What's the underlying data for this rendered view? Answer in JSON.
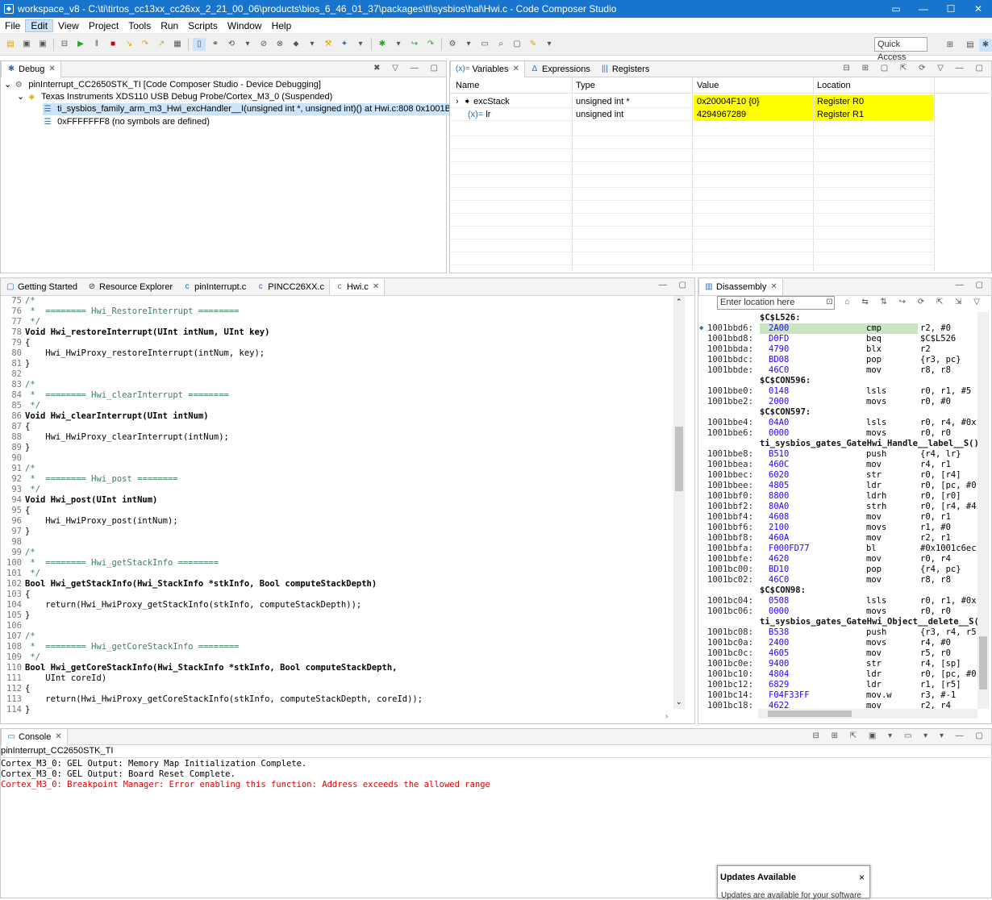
{
  "window": {
    "title": "workspace_v8 - C:\\ti\\tirtos_cc13xx_cc26xx_2_21_00_06\\products\\bios_6_46_01_37\\packages\\ti\\sysbios\\hal\\Hwi.c - Code Composer Studio",
    "minimize": "—",
    "maximize": "☐",
    "close": "✕"
  },
  "menu": [
    "File",
    "Edit",
    "View",
    "Project",
    "Tools",
    "Run",
    "Scripts",
    "Window",
    "Help"
  ],
  "quick_access": "Quick Access",
  "debug": {
    "tab": "Debug",
    "rows": [
      "pinInterrupt_CC2650STK_TI [Code Composer Studio - Device Debugging]",
      "Texas Instruments XDS110 USB Debug Probe/Cortex_M3_0 (Suspended)",
      "ti_sysbios_family_arm_m3_Hwi_excHandler__I(unsigned int *, unsigned int)() at Hwi.c:808 0x1001BBD6",
      "0xFFFFFFF8  (no symbols are defined)"
    ]
  },
  "vars": {
    "tabs": [
      "Variables",
      "Expressions",
      "Registers"
    ],
    "tab_icons": [
      "(x)=",
      "∆",
      "|||"
    ],
    "headers": [
      "Name",
      "Type",
      "Value",
      "Location"
    ],
    "rows": [
      {
        "name": "excStack",
        "type": "unsigned int *",
        "value": "0x20004F10 {0}",
        "location": "Register R0"
      },
      {
        "name": "lr",
        "type": "unsigned int",
        "value": "4294967289",
        "location": "Register R1"
      }
    ]
  },
  "editor": {
    "tabs": [
      "Getting Started",
      "Resource Explorer",
      "pinInterrupt.c",
      "PINCC26XX.c",
      "Hwi.c"
    ],
    "lines": [
      {
        "n": "75",
        "t": "/*"
      },
      {
        "n": "76",
        "t": " *  ======== Hwi_RestoreInterrupt ========"
      },
      {
        "n": "77",
        "t": " */"
      },
      {
        "n": "78",
        "t": "Void Hwi_restoreInterrupt(UInt intNum, UInt key)"
      },
      {
        "n": "79",
        "t": "{"
      },
      {
        "n": "80",
        "t": "    Hwi_HwiProxy_restoreInterrupt(intNum, key);"
      },
      {
        "n": "81",
        "t": "}"
      },
      {
        "n": "82",
        "t": ""
      },
      {
        "n": "83",
        "t": "/*"
      },
      {
        "n": "84",
        "t": " *  ======== Hwi_clearInterrupt ========"
      },
      {
        "n": "85",
        "t": " */"
      },
      {
        "n": "86",
        "t": "Void Hwi_clearInterrupt(UInt intNum)"
      },
      {
        "n": "87",
        "t": "{"
      },
      {
        "n": "88",
        "t": "    Hwi_HwiProxy_clearInterrupt(intNum);"
      },
      {
        "n": "89",
        "t": "}"
      },
      {
        "n": "90",
        "t": ""
      },
      {
        "n": "91",
        "t": "/*"
      },
      {
        "n": "92",
        "t": " *  ======== Hwi_post ========"
      },
      {
        "n": "93",
        "t": " */"
      },
      {
        "n": "94",
        "t": "Void Hwi_post(UInt intNum)"
      },
      {
        "n": "95",
        "t": "{"
      },
      {
        "n": "96",
        "t": "    Hwi_HwiProxy_post(intNum);"
      },
      {
        "n": "97",
        "t": "}"
      },
      {
        "n": "98",
        "t": ""
      },
      {
        "n": "99",
        "t": "/*"
      },
      {
        "n": "100",
        "t": " *  ======== Hwi_getStackInfo ========"
      },
      {
        "n": "101",
        "t": " */"
      },
      {
        "n": "102",
        "t": "Bool Hwi_getStackInfo(Hwi_StackInfo *stkInfo, Bool computeStackDepth)"
      },
      {
        "n": "103",
        "t": "{"
      },
      {
        "n": "104",
        "t": "    return(Hwi_HwiProxy_getStackInfo(stkInfo, computeStackDepth));"
      },
      {
        "n": "105",
        "t": "}"
      },
      {
        "n": "106",
        "t": ""
      },
      {
        "n": "107",
        "t": "/*"
      },
      {
        "n": "108",
        "t": " *  ======== Hwi_getCoreStackInfo ========"
      },
      {
        "n": "109",
        "t": " */"
      },
      {
        "n": "110",
        "t": "Bool Hwi_getCoreStackInfo(Hwi_StackInfo *stkInfo, Bool computeStackDepth,"
      },
      {
        "n": "111",
        "t": "    UInt coreId)"
      },
      {
        "n": "112",
        "t": "{"
      },
      {
        "n": "113",
        "t": "    return(Hwi_HwiProxy_getCoreStackInfo(stkInfo, computeStackDepth, coreId));"
      },
      {
        "n": "114",
        "t": "}"
      }
    ]
  },
  "disasm": {
    "tab": "Disassembly",
    "location_placeholder": "Enter location here",
    "lines": [
      {
        "label": "$C$L526:"
      },
      {
        "a": "1001bbd6:",
        "o": "2A00",
        "m": "cmp",
        "r": "r2, #0",
        "cur": true
      },
      {
        "a": "1001bbd8:",
        "o": "D0FD",
        "m": "beq",
        "r": "$C$L526"
      },
      {
        "a": "1001bbda:",
        "o": "4790",
        "m": "blx",
        "r": "r2"
      },
      {
        "a": "1001bbdc:",
        "o": "BD08",
        "m": "pop",
        "r": "{r3, pc}"
      },
      {
        "a": "1001bbde:",
        "o": "46C0",
        "m": "mov",
        "r": "r8, r8"
      },
      {
        "label": "$C$CON596:"
      },
      {
        "a": "1001bbe0:",
        "o": "0148",
        "m": "lsls",
        "r": "r0, r1, #5"
      },
      {
        "a": "1001bbe2:",
        "o": "2000",
        "m": "movs",
        "r": "r0, #0"
      },
      {
        "label": "$C$CON597:"
      },
      {
        "a": "1001bbe4:",
        "o": "04A0",
        "m": "lsls",
        "r": "r0, r4, #0x"
      },
      {
        "a": "1001bbe6:",
        "o": "0000",
        "m": "movs",
        "r": "r0, r0"
      },
      {
        "label": "ti_sysbios_gates_GateHwi_Handle__label__S(),"
      },
      {
        "a": "1001bbe8:",
        "o": "B510",
        "m": "push",
        "r": "{r4, lr}"
      },
      {
        "a": "1001bbea:",
        "o": "460C",
        "m": "mov",
        "r": "r4, r1"
      },
      {
        "a": "1001bbec:",
        "o": "6020",
        "m": "str",
        "r": "r0, [r4]"
      },
      {
        "a": "1001bbee:",
        "o": "4805",
        "m": "ldr",
        "r": "r0, [pc, #0"
      },
      {
        "a": "1001bbf0:",
        "o": "8800",
        "m": "ldrh",
        "r": "r0, [r0]"
      },
      {
        "a": "1001bbf2:",
        "o": "80A0",
        "m": "strh",
        "r": "r0, [r4, #4"
      },
      {
        "a": "1001bbf4:",
        "o": "4608",
        "m": "mov",
        "r": "r0, r1"
      },
      {
        "a": "1001bbf6:",
        "o": "2100",
        "m": "movs",
        "r": "r1, #0"
      },
      {
        "a": "1001bbf8:",
        "o": "460A",
        "m": "mov",
        "r": "r2, r1"
      },
      {
        "a": "1001bbfa:",
        "o": "F000FD77",
        "m": "bl",
        "r": "#0x1001c6ec"
      },
      {
        "a": "1001bbfe:",
        "o": "4620",
        "m": "mov",
        "r": "r0, r4"
      },
      {
        "a": "1001bc00:",
        "o": "BD10",
        "m": "pop",
        "r": "{r4, pc}"
      },
      {
        "a": "1001bc02:",
        "o": "46C0",
        "m": "mov",
        "r": "r8, r8"
      },
      {
        "label": "$C$CON98:"
      },
      {
        "a": "1001bc04:",
        "o": "0508",
        "m": "lsls",
        "r": "r0, r1, #0x"
      },
      {
        "a": "1001bc06:",
        "o": "0000",
        "m": "movs",
        "r": "r0, r0"
      },
      {
        "label": "ti_sysbios_gates_GateHwi_Object__delete__S()"
      },
      {
        "a": "1001bc08:",
        "o": "B538",
        "m": "push",
        "r": "{r3, r4, r5"
      },
      {
        "a": "1001bc0a:",
        "o": "2400",
        "m": "movs",
        "r": "r4, #0"
      },
      {
        "a": "1001bc0c:",
        "o": "4605",
        "m": "mov",
        "r": "r5, r0"
      },
      {
        "a": "1001bc0e:",
        "o": "9400",
        "m": "str",
        "r": "r4, [sp]"
      },
      {
        "a": "1001bc10:",
        "o": "4804",
        "m": "ldr",
        "r": "r0, [pc, #0"
      },
      {
        "a": "1001bc12:",
        "o": "6829",
        "m": "ldr",
        "r": "r1, [r5]"
      },
      {
        "a": "1001bc14:",
        "o": "F04F33FF",
        "m": "mov.w",
        "r": "r3, #-1"
      },
      {
        "a": "1001bc18:",
        "o": "4622",
        "m": "mov",
        "r": "r2, r4"
      }
    ]
  },
  "console": {
    "tab": "Console",
    "session": "pinInterrupt_CC2650STK_TI",
    "lines": [
      {
        "t": "Cortex_M3_0: GEL Output: Memory Map Initialization Complete.",
        "err": false
      },
      {
        "t": "Cortex_M3_0: GEL Output: Board Reset Complete.",
        "err": false
      },
      {
        "t": "Cortex_M3_0: Breakpoint Manager: Error enabling this function: Address exceeds the allowed range",
        "err": true
      }
    ]
  },
  "notification": {
    "title": "Updates Available",
    "body": "Updates are available for your software",
    "close": "×"
  },
  "colors": {
    "titlebar": "#1874cd",
    "highlight": "#ffff00",
    "error": "#e00000",
    "current_line": "#c8e6c0"
  }
}
